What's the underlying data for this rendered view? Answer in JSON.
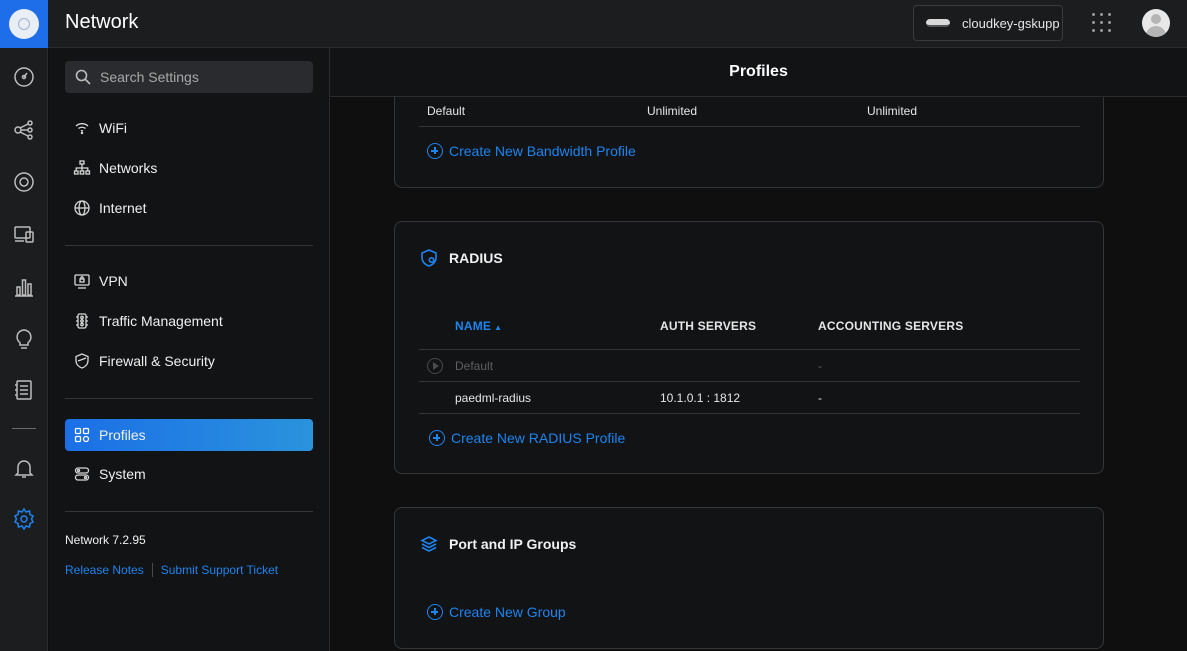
{
  "app": {
    "title": "Network"
  },
  "topbar": {
    "console_name": "cloudkey-gskupp"
  },
  "search": {
    "placeholder": "Search Settings"
  },
  "sidebar": {
    "items": [
      {
        "label": "WiFi",
        "icon": "wifi-icon"
      },
      {
        "label": "Networks",
        "icon": "networks-icon"
      },
      {
        "label": "Internet",
        "icon": "globe-icon"
      },
      {
        "label": "VPN",
        "icon": "vpn-icon"
      },
      {
        "label": "Traffic Management",
        "icon": "traffic-icon"
      },
      {
        "label": "Firewall & Security",
        "icon": "shield-icon"
      },
      {
        "label": "Profiles",
        "icon": "profiles-icon",
        "active": true
      },
      {
        "label": "System",
        "icon": "system-icon"
      }
    ],
    "version": "Network 7.2.95",
    "release_notes": "Release Notes",
    "support": "Submit Support Ticket"
  },
  "main": {
    "title": "Profiles",
    "bandwidth": {
      "row": [
        "Default",
        "Unlimited",
        "Unlimited"
      ],
      "create_label": "Create New Bandwidth Profile"
    },
    "radius": {
      "title": "RADIUS",
      "columns": [
        "NAME",
        "AUTH SERVERS",
        "ACCOUNTING SERVERS"
      ],
      "rows": [
        {
          "name": "Default",
          "auth": "",
          "acct": "-"
        },
        {
          "name": "paedml-radius",
          "auth": "10.1.0.1 : 1812",
          "acct": "-"
        }
      ],
      "create_label": "Create New RADIUS Profile"
    },
    "groups": {
      "title": "Port and IP Groups",
      "create_label": "Create New Group"
    }
  },
  "colors": {
    "accent": "#1d84f0",
    "brand": "#1d6ee8",
    "background": "#0f0f10"
  }
}
